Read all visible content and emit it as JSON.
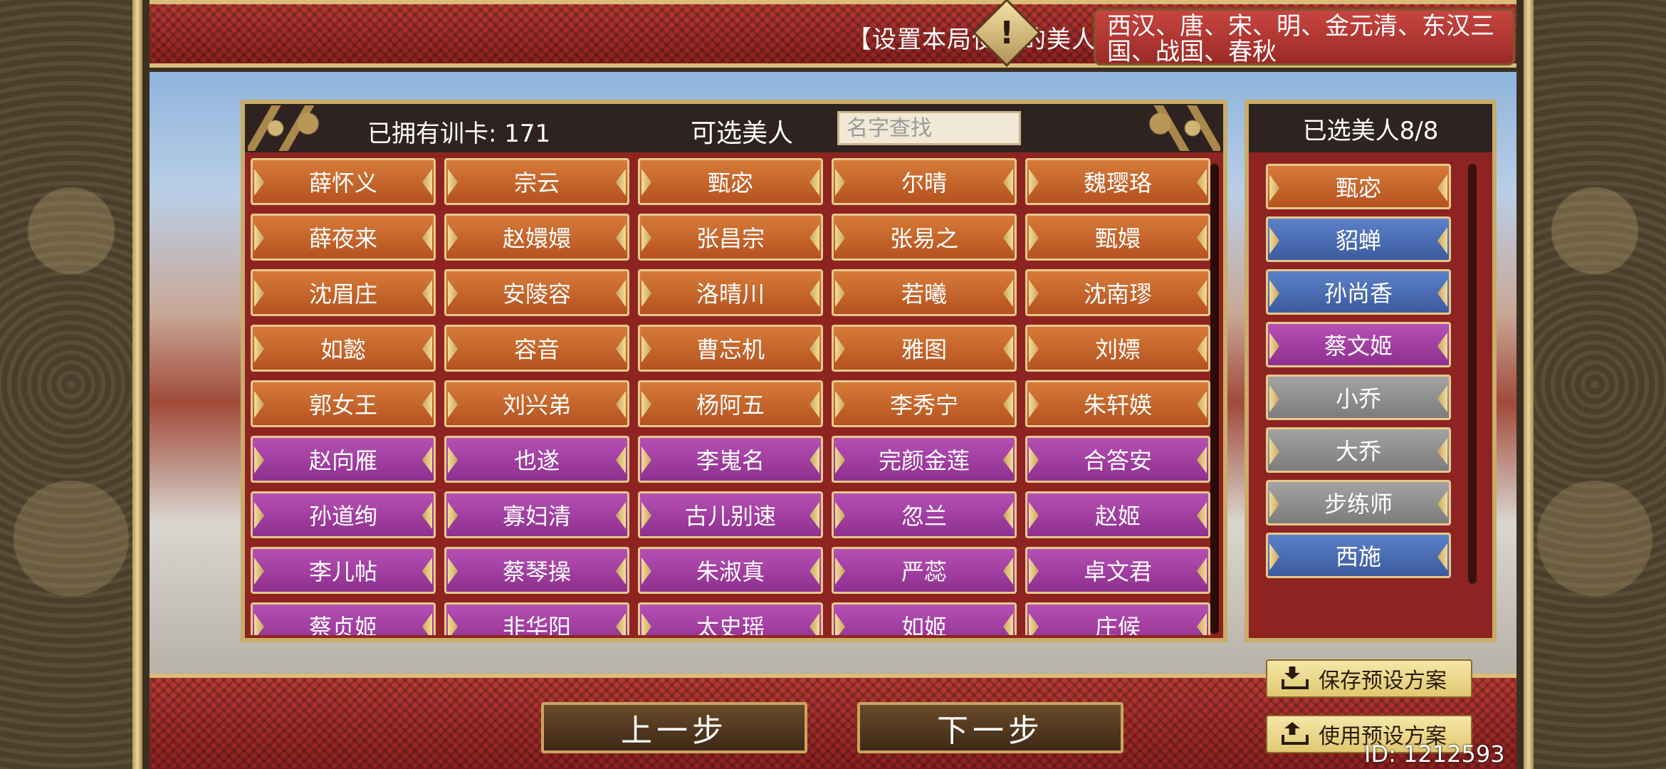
{
  "header": {
    "title": "【设置本局使用的美人】",
    "dynasties": "西汉、唐、宋、明、金元清、东汉三国、战国、春秋"
  },
  "available_panel": {
    "owned_cards_label": "已拥有训卡: 171",
    "selectable_label": "可选美人",
    "search_placeholder": "名字查找",
    "beauties": [
      {
        "name": "薛怀义",
        "rarity": "orange"
      },
      {
        "name": "宗云",
        "rarity": "orange"
      },
      {
        "name": "甄宓",
        "rarity": "orange"
      },
      {
        "name": "尔晴",
        "rarity": "orange"
      },
      {
        "name": "魏璎珞",
        "rarity": "orange"
      },
      {
        "name": "薛夜来",
        "rarity": "orange"
      },
      {
        "name": "赵嬛嬛",
        "rarity": "orange"
      },
      {
        "name": "张昌宗",
        "rarity": "orange"
      },
      {
        "name": "张易之",
        "rarity": "orange"
      },
      {
        "name": "甄嬛",
        "rarity": "orange"
      },
      {
        "name": "沈眉庄",
        "rarity": "orange"
      },
      {
        "name": "安陵容",
        "rarity": "orange"
      },
      {
        "name": "洛晴川",
        "rarity": "orange"
      },
      {
        "name": "若曦",
        "rarity": "orange"
      },
      {
        "name": "沈南璆",
        "rarity": "orange"
      },
      {
        "name": "如懿",
        "rarity": "orange"
      },
      {
        "name": "容音",
        "rarity": "orange"
      },
      {
        "name": "曹忘机",
        "rarity": "orange"
      },
      {
        "name": "雅图",
        "rarity": "orange"
      },
      {
        "name": "刘嫖",
        "rarity": "orange"
      },
      {
        "name": "郭女王",
        "rarity": "orange"
      },
      {
        "name": "刘兴弟",
        "rarity": "orange"
      },
      {
        "name": "杨阿五",
        "rarity": "orange"
      },
      {
        "name": "李秀宁",
        "rarity": "orange"
      },
      {
        "name": "朱轩媖",
        "rarity": "orange"
      },
      {
        "name": "赵向雁",
        "rarity": "purple"
      },
      {
        "name": "也遂",
        "rarity": "purple"
      },
      {
        "name": "李嵬名",
        "rarity": "purple"
      },
      {
        "name": "完颜金莲",
        "rarity": "purple"
      },
      {
        "name": "合答安",
        "rarity": "purple"
      },
      {
        "name": "孙道绚",
        "rarity": "purple"
      },
      {
        "name": "寡妇清",
        "rarity": "purple"
      },
      {
        "name": "古儿别速",
        "rarity": "purple"
      },
      {
        "name": "忽兰",
        "rarity": "purple"
      },
      {
        "name": "赵姬",
        "rarity": "purple"
      },
      {
        "name": "李儿帖",
        "rarity": "purple"
      },
      {
        "name": "蔡琴操",
        "rarity": "purple"
      },
      {
        "name": "朱淑真",
        "rarity": "purple"
      },
      {
        "name": "严蕊",
        "rarity": "purple"
      },
      {
        "name": "卓文君",
        "rarity": "purple"
      },
      {
        "name": "蔡贞姬",
        "rarity": "purple"
      },
      {
        "name": "非华阳",
        "rarity": "purple"
      },
      {
        "name": "太史瑶",
        "rarity": "purple"
      },
      {
        "name": "如姬",
        "rarity": "purple"
      },
      {
        "name": "庄候",
        "rarity": "purple"
      }
    ]
  },
  "selected_panel": {
    "title": "已选美人8/8",
    "beauties": [
      {
        "name": "甄宓",
        "rarity": "orange"
      },
      {
        "name": "貂蝉",
        "rarity": "blue"
      },
      {
        "name": "孙尚香",
        "rarity": "blue"
      },
      {
        "name": "蔡文姬",
        "rarity": "purple"
      },
      {
        "name": "小乔",
        "rarity": "gray"
      },
      {
        "name": "大乔",
        "rarity": "gray"
      },
      {
        "name": "步练师",
        "rarity": "gray"
      },
      {
        "name": "西施",
        "rarity": "blue"
      }
    ]
  },
  "presets": {
    "save_label": "保存预设方案",
    "use_label": "使用预设方案"
  },
  "navigation": {
    "prev_label": "上一步",
    "next_label": "下一步"
  },
  "footer": {
    "id_text": "ID: 1212593"
  },
  "colors": {
    "orange": "#c96a2e",
    "purple": "#a244a3",
    "blue": "#4b6db4",
    "gray": "#909090",
    "frame_gold": "#c9ad68",
    "panel_red": "#8e2421"
  }
}
